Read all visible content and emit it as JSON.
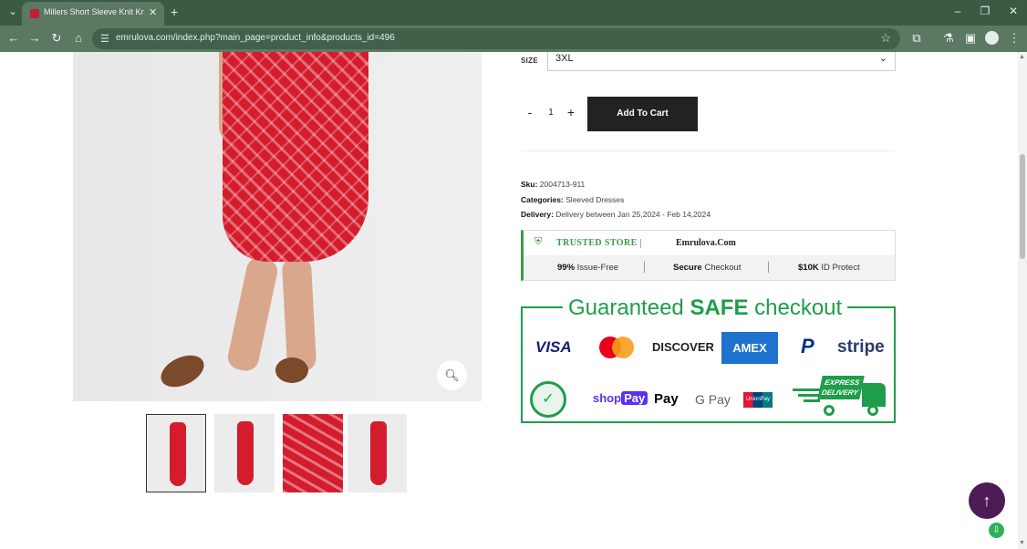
{
  "browser": {
    "tab_title": "Millers Short Sleeve Knit Knee l",
    "url": "emrulova.com/index.php?main_page=product_info&products_id=496",
    "icons": {
      "tab_menu": "chevron-down-icon",
      "tab_close": "close-icon",
      "new_tab": "plus-icon",
      "minimize": "minimize-icon",
      "restore": "restore-icon",
      "close": "close-icon",
      "back": "back-arrow-icon",
      "forward": "forward-arrow-icon",
      "reload": "reload-icon",
      "home": "home-icon",
      "site_info": "tune-icon",
      "bookmark": "star-icon",
      "extensions": "puzzle-icon",
      "labs": "flask-icon",
      "sidepanel": "sidepanel-icon",
      "profile": "profile-icon",
      "menu": "kebab-icon"
    },
    "colors": {
      "frame": "#3b5a44",
      "toolbar": "#5a7862"
    }
  },
  "product": {
    "size_label": "SIZE",
    "size_value": "3XL",
    "quantity": "1",
    "qty_minus": "-",
    "qty_plus": "+",
    "add_to_cart": "Add To Cart",
    "sku_label": "Sku:",
    "sku": "2004713-911",
    "categories_label": "Categories:",
    "categories": "Sleeved Dresses",
    "delivery_label": "Delivery:",
    "delivery": "Delivery between Jan 25,2024 - Feb 14,2024"
  },
  "trust": {
    "badge": "TRUSTED STORE",
    "site": "Emrulova.Com",
    "items": [
      {
        "bold": "99%",
        "text": "Issue-Free"
      },
      {
        "bold": "Secure",
        "text": "Checkout"
      },
      {
        "bold": "$10K",
        "text": "ID Protect"
      }
    ]
  },
  "guarantee": {
    "title_pre": "Guaranteed",
    "title_bold": "SAFE",
    "title_post": "checkout",
    "logos_row1": [
      "VISA",
      "mastercard",
      "DISCOVER",
      "AMEX",
      "PayPal",
      "stripe"
    ],
    "visa": "VISA",
    "discover": "DISCOVER",
    "amex": "AMEX",
    "paypal": "P",
    "stripe": "stripe",
    "shop": "shop",
    "pay": "Pay",
    "applepay": "Pay",
    "gpay": "G Pay",
    "unionpay": "UnionPay",
    "express_top": "EXPRESS",
    "express_bottom": "DELIVERY",
    "color": "#1f9d4a"
  },
  "gallery": {
    "zoom_icon": "zoom-in-icon",
    "thumbnails": 4
  },
  "floating": {
    "scroll_top_icon": "arrow-up-icon",
    "ext_icon": "download-icon"
  }
}
